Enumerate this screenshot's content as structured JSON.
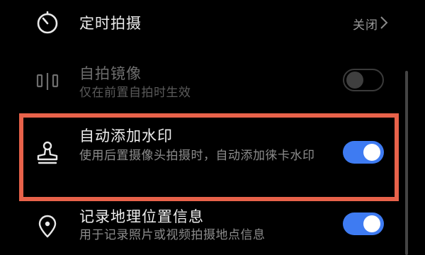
{
  "settings": {
    "timer": {
      "title": "定时拍摄",
      "value": "关闭",
      "icon": "timer-icon"
    },
    "mirror": {
      "title": "自拍镜像",
      "subtitle": "仅在前置自拍时生效",
      "enabled": false,
      "disabled": true,
      "icon": "mirror-icon"
    },
    "watermark": {
      "title": "自动添加水印",
      "subtitle": "使用后置摄像头拍摄时，自动添加徕卡水印",
      "enabled": true,
      "icon": "stamp-icon"
    },
    "location": {
      "title": "记录地理位置信息",
      "subtitle": "用于记录照片或视频拍摄地点信息",
      "enabled": true,
      "icon": "location-pin-icon"
    }
  },
  "colors": {
    "background": "#000000",
    "toggle_on": "#3e7bf2",
    "highlight": "#e8624a"
  }
}
